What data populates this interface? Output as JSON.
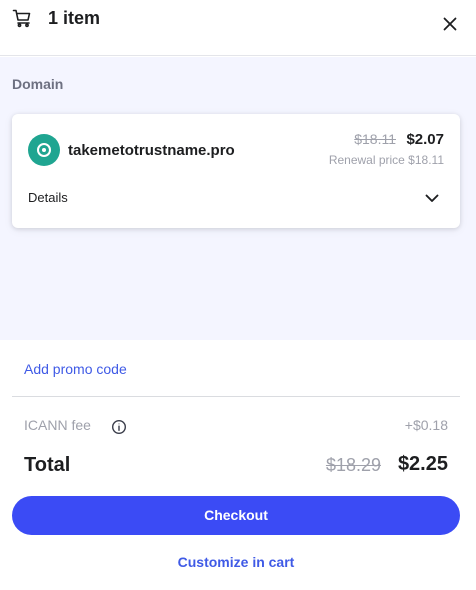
{
  "header": {
    "title": "1 item",
    "cart_icon": "cart-icon",
    "close_icon": "close-icon"
  },
  "items_section": {
    "label": "Domain",
    "items": [
      {
        "icon": "domain-target-icon",
        "name": "takemetotrustname.pro",
        "old_price": "$18.11",
        "new_price": "$2.07",
        "renewal": "Renewal price $18.11",
        "details_label": "Details",
        "details_icon": "chevron-down-icon"
      }
    ]
  },
  "promo": {
    "label": "Add promo code"
  },
  "fees": {
    "icann_label": "ICANN fee",
    "icann_icon": "info-icon",
    "icann_value": "+$0.18"
  },
  "total": {
    "label": "Total",
    "old": "$18.29",
    "new": "$2.25"
  },
  "actions": {
    "checkout_label": "Checkout",
    "customize_label": "Customize in cart"
  },
  "colors": {
    "accent": "#3b4bf5",
    "link": "#3f5ae6",
    "domain_icon_bg": "#1fa591",
    "panel_bg": "#f4f5ff",
    "muted_text": "#9fa1ab"
  }
}
